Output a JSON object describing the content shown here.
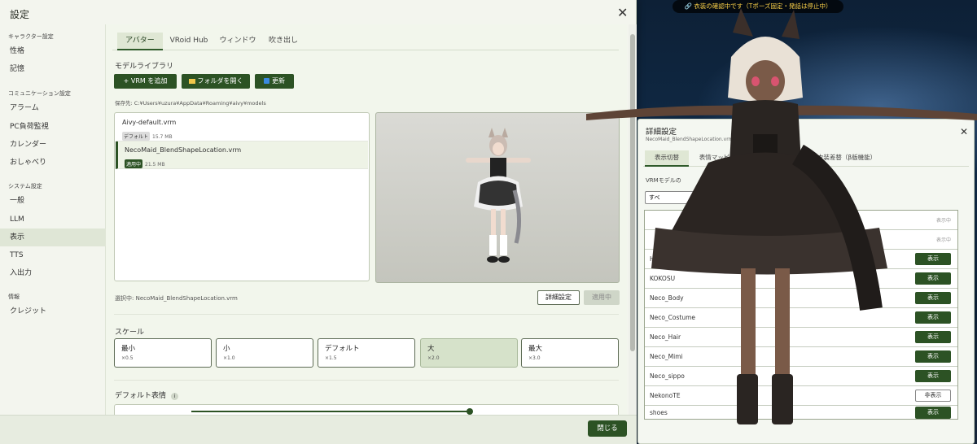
{
  "window": {
    "title": "設定",
    "close_glyph": "✕"
  },
  "sidebar": {
    "sections": [
      {
        "label": "キャラクター設定",
        "items": [
          "性格",
          "記憶"
        ]
      },
      {
        "label": "コミュニケーション設定",
        "items": [
          "アラーム",
          "PC負荷監視",
          "カレンダー",
          "おしゃべり"
        ]
      },
      {
        "label": "システム設定",
        "items": [
          "一般",
          "LLM",
          "表示",
          "TTS",
          "入出力"
        ]
      },
      {
        "label": "情報",
        "items": [
          "クレジット"
        ]
      }
    ],
    "active_item": "表示"
  },
  "tabs": [
    "アバター",
    "VRoid Hub",
    "ウィンドウ",
    "吹き出し"
  ],
  "active_tab": "アバター",
  "library": {
    "heading": "モデルライブラリ",
    "add_vrm_label": "+ VRM を追加",
    "open_folder_label": "フォルダを開く",
    "refresh_label": "更新",
    "save_path": "保存先: C:¥Users¥uzura¥AppData¥Roaming¥aivy¥models",
    "models": [
      {
        "name": "Aivy-default.vrm",
        "badge": "デフォルト",
        "size": "15.7 MB"
      },
      {
        "name": "NecoMaid_BlendShapeLocation.vrm",
        "badge": "適用中",
        "size": "21.5 MB"
      }
    ],
    "selected_text": "選択中: NecoMaid_BlendShapeLocation.vrm",
    "details_label": "詳細設定",
    "apply_label": "適用中"
  },
  "scale": {
    "heading": "スケール",
    "options": [
      {
        "name": "最小",
        "value": "×0.5"
      },
      {
        "name": "小",
        "value": "×1.0"
      },
      {
        "name": "デフォルト",
        "value": "×1.5"
      },
      {
        "name": "大",
        "value": "×2.0"
      },
      {
        "name": "最大",
        "value": "×3.0"
      }
    ],
    "selected": "大"
  },
  "default_expression": {
    "heading": "デフォルト表情",
    "info_glyph": "i"
  },
  "footer": {
    "close_label": "閉じる"
  },
  "overlay": {
    "status_text": "衣装の確認中です（Tポーズ固定・発話は停止中）",
    "link_glyph": "🔗"
  },
  "detail_panel": {
    "title": "詳細設定",
    "subtitle": "NecoMaid_BlendShapeLocation.vrm",
    "tabs": [
      "表示切替",
      "表情マッピング",
      "衣装差替（β版機能）"
    ],
    "active_tab": "表示切替",
    "label": "VRMモデルの",
    "select_value": "すべ",
    "meshes": [
      {
        "name": "",
        "state": "表示中",
        "button": ""
      },
      {
        "name": "",
        "state": "表示中",
        "button": ""
      },
      {
        "name": "Hi",
        "state": "",
        "button": "表示"
      },
      {
        "name": "KOKOSU",
        "state": "",
        "button": "表示"
      },
      {
        "name": "Neco_Body",
        "state": "",
        "button": "表示"
      },
      {
        "name": "Neco_Costume",
        "state": "",
        "button": "表示"
      },
      {
        "name": "Neco_Hair",
        "state": "",
        "button": "表示"
      },
      {
        "name": "Neco_Mimi",
        "state": "",
        "button": "表示"
      },
      {
        "name": "Neco_sippo",
        "state": "",
        "button": "表示"
      },
      {
        "name": "NekonoTE",
        "state": "",
        "button": "非表示"
      },
      {
        "name": "shoes",
        "state": "",
        "button": "表示"
      }
    ],
    "close_glyph": "✕"
  },
  "colors": {
    "accent": "#2c5224",
    "panel_bg": "#f3f5ee",
    "overlay_text": "#ffd44a"
  }
}
